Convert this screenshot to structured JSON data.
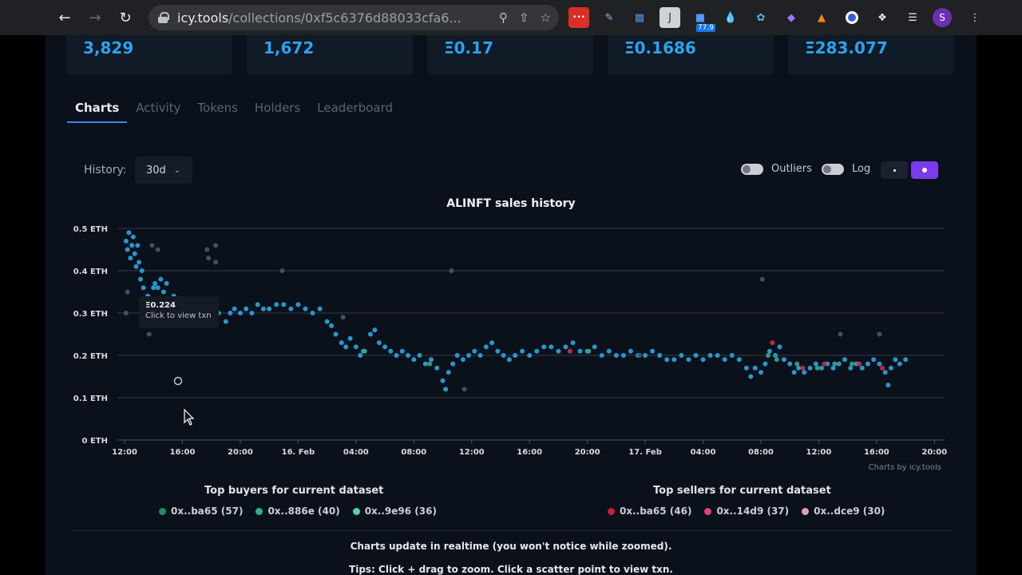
{
  "browser": {
    "url_host": "icy.tools",
    "url_path": "/collections/0xf5c6376d88033cfa6...",
    "extension_badge": "77.9",
    "profile_initial": "S"
  },
  "stats": [
    "3,829",
    "1,672",
    "Ξ0.17",
    "Ξ0.1686",
    "Ξ283.077"
  ],
  "tabs": [
    "Charts",
    "Activity",
    "Tokens",
    "Holders",
    "Leaderboard"
  ],
  "history": {
    "label": "History:",
    "value": "30d"
  },
  "toggles": {
    "outliers": "Outliers",
    "log": "Log"
  },
  "tooltip": {
    "price": "Ξ0.224",
    "hint": "Click to view txn"
  },
  "credit": "Charts by icy.tools",
  "top_buyers": {
    "title": "Top buyers for current dataset",
    "items": [
      {
        "label": "0x..ba65 (57)",
        "color": "#1f8f5a"
      },
      {
        "label": "0x..886e (40)",
        "color": "#2bb582"
      },
      {
        "label": "0x..9e96 (36)",
        "color": "#56d3a5"
      }
    ]
  },
  "top_sellers": {
    "title": "Top sellers for current dataset",
    "items": [
      {
        "label": "0x..ba65 (46)",
        "color": "#c41e3a"
      },
      {
        "label": "0x..14d9 (37)",
        "color": "#e0446e"
      },
      {
        "label": "0x..dce9 (30)",
        "color": "#d9a3b8"
      }
    ]
  },
  "notes": {
    "realtime": "Charts update in realtime (you won't notice while zoomed).",
    "tips": "Tips: Click + drag to zoom. Click a scatter point to view txn."
  },
  "chart_data": {
    "type": "scatter",
    "title": "ALINFT sales history",
    "y_ticks": [
      "0 ETH",
      "0.1 ETH",
      "0.2 ETH",
      "0.3 ETH",
      "0.4 ETH",
      "0.5 ETH"
    ],
    "ylim": [
      0,
      0.5
    ],
    "x_ticks": [
      "12:00",
      "16:00",
      "20:00",
      "16. Feb",
      "04:00",
      "08:00",
      "12:00",
      "16:00",
      "20:00",
      "17. Feb",
      "04:00",
      "08:00",
      "12:00",
      "16:00",
      "20:00"
    ],
    "xlim_hours": [
      -0.5,
      56.7
    ],
    "grid": true,
    "series": [
      {
        "color": "#2aa6e0",
        "points": [
          [
            0.1,
            0.47
          ],
          [
            0.2,
            0.45
          ],
          [
            0.3,
            0.49
          ],
          [
            0.4,
            0.43
          ],
          [
            0.5,
            0.46
          ],
          [
            0.6,
            0.48
          ],
          [
            0.7,
            0.44
          ],
          [
            0.8,
            0.41
          ],
          [
            0.9,
            0.46
          ],
          [
            1.0,
            0.42
          ],
          [
            1.1,
            0.38
          ],
          [
            1.2,
            0.4
          ],
          [
            1.3,
            0.36
          ],
          [
            1.5,
            0.33
          ],
          [
            1.6,
            0.34
          ],
          [
            1.8,
            0.31
          ],
          [
            2.0,
            0.36
          ],
          [
            2.1,
            0.37
          ],
          [
            2.3,
            0.36
          ],
          [
            2.5,
            0.38
          ],
          [
            2.7,
            0.35
          ],
          [
            2.9,
            0.37
          ],
          [
            3.1,
            0.33
          ],
          [
            3.4,
            0.34
          ],
          [
            3.7,
            0.31
          ],
          [
            4.0,
            0.3
          ],
          [
            4.3,
            0.31
          ],
          [
            4.7,
            0.29
          ],
          [
            5.0,
            0.3
          ],
          [
            6.0,
            0.29
          ],
          [
            6.5,
            0.3
          ],
          [
            7.0,
            0.28
          ],
          [
            7.3,
            0.3
          ],
          [
            7.6,
            0.31
          ],
          [
            8.0,
            0.3
          ],
          [
            8.4,
            0.31
          ],
          [
            8.8,
            0.3
          ],
          [
            9.2,
            0.32
          ],
          [
            9.6,
            0.31
          ],
          [
            10.0,
            0.31
          ],
          [
            10.5,
            0.32
          ],
          [
            11.0,
            0.32
          ],
          [
            11.5,
            0.31
          ],
          [
            12.0,
            0.32
          ],
          [
            12.5,
            0.31
          ],
          [
            13.0,
            0.3
          ],
          [
            13.5,
            0.31
          ],
          [
            14.0,
            0.28
          ],
          [
            14.3,
            0.27
          ],
          [
            14.6,
            0.25
          ],
          [
            15.0,
            0.23
          ],
          [
            15.3,
            0.22
          ],
          [
            15.6,
            0.24
          ],
          [
            16.0,
            0.22
          ],
          [
            16.3,
            0.2
          ],
          [
            16.6,
            0.21
          ],
          [
            17.0,
            0.25
          ],
          [
            17.3,
            0.26
          ],
          [
            17.6,
            0.23
          ],
          [
            18.0,
            0.22
          ],
          [
            18.4,
            0.21
          ],
          [
            18.8,
            0.2
          ],
          [
            19.2,
            0.21
          ],
          [
            19.6,
            0.2
          ],
          [
            20.0,
            0.19
          ],
          [
            20.4,
            0.2
          ],
          [
            20.8,
            0.18
          ],
          [
            21.2,
            0.19
          ],
          [
            21.6,
            0.17
          ],
          [
            22.0,
            0.14
          ],
          [
            22.2,
            0.12
          ],
          [
            22.4,
            0.16
          ],
          [
            22.7,
            0.18
          ],
          [
            23.0,
            0.2
          ],
          [
            23.4,
            0.19
          ],
          [
            23.8,
            0.2
          ],
          [
            24.2,
            0.21
          ],
          [
            24.6,
            0.2
          ],
          [
            25.0,
            0.22
          ],
          [
            25.4,
            0.23
          ],
          [
            25.8,
            0.21
          ],
          [
            26.2,
            0.2
          ],
          [
            26.6,
            0.19
          ],
          [
            27.0,
            0.2
          ],
          [
            27.5,
            0.21
          ],
          [
            28.0,
            0.2
          ],
          [
            28.5,
            0.21
          ],
          [
            29.0,
            0.22
          ],
          [
            29.5,
            0.22
          ],
          [
            30.0,
            0.21
          ],
          [
            30.5,
            0.22
          ],
          [
            31.0,
            0.23
          ],
          [
            31.5,
            0.21
          ],
          [
            32.0,
            0.21
          ],
          [
            32.5,
            0.22
          ],
          [
            33.0,
            0.2
          ],
          [
            33.5,
            0.21
          ],
          [
            34.0,
            0.2
          ],
          [
            34.5,
            0.2
          ],
          [
            35.0,
            0.21
          ],
          [
            35.5,
            0.2
          ],
          [
            36.0,
            0.2
          ],
          [
            36.5,
            0.21
          ],
          [
            37.0,
            0.2
          ],
          [
            37.5,
            0.19
          ],
          [
            38.0,
            0.19
          ],
          [
            38.5,
            0.2
          ],
          [
            39.0,
            0.19
          ],
          [
            39.5,
            0.2
          ],
          [
            40.0,
            0.19
          ],
          [
            40.5,
            0.2
          ],
          [
            41.0,
            0.2
          ],
          [
            41.5,
            0.19
          ],
          [
            42.0,
            0.2
          ],
          [
            42.5,
            0.19
          ],
          [
            43.0,
            0.17
          ],
          [
            43.3,
            0.15
          ],
          [
            43.6,
            0.17
          ],
          [
            44.0,
            0.16
          ],
          [
            44.3,
            0.18
          ],
          [
            44.6,
            0.21
          ],
          [
            45.0,
            0.2
          ],
          [
            45.3,
            0.22
          ],
          [
            45.6,
            0.19
          ],
          [
            46.0,
            0.18
          ],
          [
            46.3,
            0.16
          ],
          [
            46.6,
            0.17
          ],
          [
            47.0,
            0.16
          ],
          [
            47.4,
            0.17
          ],
          [
            47.8,
            0.18
          ],
          [
            48.2,
            0.17
          ],
          [
            48.6,
            0.18
          ],
          [
            49.0,
            0.17
          ],
          [
            49.4,
            0.18
          ],
          [
            49.8,
            0.19
          ],
          [
            50.2,
            0.17
          ],
          [
            50.6,
            0.18
          ],
          [
            51.0,
            0.17
          ],
          [
            51.4,
            0.18
          ],
          [
            51.8,
            0.19
          ],
          [
            52.2,
            0.18
          ],
          [
            52.6,
            0.16
          ],
          [
            52.8,
            0.13
          ],
          [
            53.0,
            0.17
          ],
          [
            53.3,
            0.19
          ],
          [
            53.6,
            0.18
          ],
          [
            54.0,
            0.19
          ]
        ]
      },
      {
        "color": "#3aa882",
        "points": [
          [
            16.5,
            0.21
          ],
          [
            21.1,
            0.18
          ],
          [
            32.1,
            0.21
          ],
          [
            44.5,
            0.2
          ],
          [
            45.1,
            0.19
          ],
          [
            46.5,
            0.18
          ],
          [
            47.9,
            0.17
          ],
          [
            49.1,
            0.18
          ],
          [
            50.3,
            0.18
          ]
        ]
      },
      {
        "color": "#c8314e",
        "points": [
          [
            30.8,
            0.21
          ],
          [
            44.8,
            0.23
          ],
          [
            46.9,
            0.17
          ],
          [
            48.4,
            0.18
          ],
          [
            50.8,
            0.18
          ],
          [
            52.4,
            0.17
          ]
        ]
      },
      {
        "color": "#3f5a72",
        "points": [
          [
            1.9,
            0.46
          ],
          [
            2.3,
            0.45
          ],
          [
            5.7,
            0.45
          ],
          [
            5.8,
            0.43
          ],
          [
            6.3,
            0.46
          ],
          [
            6.3,
            0.42
          ],
          [
            10.9,
            0.4
          ],
          [
            22.6,
            0.4
          ],
          [
            44.1,
            0.38
          ],
          [
            52.2,
            0.25
          ],
          [
            49.5,
            0.25
          ],
          [
            35.6,
            0.2
          ],
          [
            0.1,
            0.3
          ],
          [
            0.2,
            0.35
          ],
          [
            1.7,
            0.25
          ],
          [
            15.1,
            0.29
          ],
          [
            23.5,
            0.12
          ]
        ]
      }
    ]
  }
}
